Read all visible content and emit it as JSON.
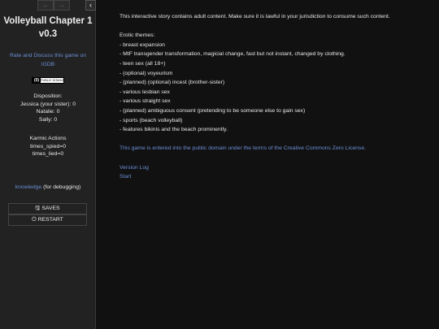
{
  "sidebar": {
    "nav_back_icon": "left-arrow-icon",
    "nav_forward_icon": "right-arrow-icon",
    "collapse_icon": "chevron-left-icon",
    "nav_back_glyph": "←",
    "nav_forward_glyph": "→",
    "collapse_glyph": "‹",
    "title": "Volleyball Chapter 1 v0.3",
    "rate_link": "Rate and Discuss this game on IGDB",
    "badge_mark": "(0)",
    "badge_text": "PUBLIC DOMAIN",
    "disposition_heading": "Disposition:",
    "disposition": [
      "Jessica (your sister): 0",
      "Natalie: 0",
      "Sally: 0"
    ],
    "karmic_heading": "Karmic Actions",
    "karmic": [
      "times_spied=0",
      "times_lied=0"
    ],
    "debug_link": "knowledge",
    "debug_note": " (for debugging)",
    "saves_label": "SAVES",
    "saves_icon": "floppy-disk-icon",
    "restart_label": "RESTART",
    "restart_icon": "power-icon"
  },
  "passage": {
    "warning": "This interactive story contains adult content. Make sure it is lawful in your jurisdiction to consume such content.",
    "themes_heading": "Erotic themes:",
    "themes": [
      "- breast expansion",
      "- MtF transgender transformation, magicial change, fast but not instant, changed by clothing.",
      "- teen sex (all 18+)",
      "- (optional) voyeurism",
      "- (planned) (optional) incest (brother-sister)",
      "- various lesbian sex",
      "- various straight sex",
      "- (planned) ambiguous consent (pretending to be someone else to gain sex)",
      "- sports (beach volleyball)",
      "- features bikinis and the beach prominently."
    ],
    "license": "This game is entered into the public domain under the terms of the Creative Commons Zero License.",
    "version_log": "Version Log",
    "start": "Start"
  },
  "colors": {
    "background": "#111111",
    "sidebar": "#222222",
    "link": "#6c8fd8",
    "text": "#e8e8e8"
  }
}
